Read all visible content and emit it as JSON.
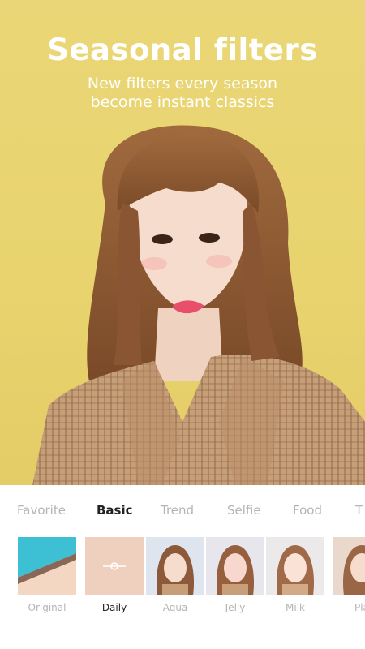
{
  "hero": {
    "title": "Seasonal filters",
    "subtitle_line1": "New filters every season",
    "subtitle_line2": "become instant classics",
    "background_color": "#e8d36e"
  },
  "category_tabs": [
    {
      "label": "Favorite",
      "active": false
    },
    {
      "label": "Basic",
      "active": true
    },
    {
      "label": "Trend",
      "active": false
    },
    {
      "label": "Selfie",
      "active": false
    },
    {
      "label": "Food",
      "active": false
    },
    {
      "label": "T",
      "active": false
    }
  ],
  "filters": [
    {
      "label": "Original",
      "active": false
    },
    {
      "label": "Daily",
      "active": true
    },
    {
      "label": "Aqua",
      "active": false
    },
    {
      "label": "Jelly",
      "active": false
    },
    {
      "label": "Milk",
      "active": false
    },
    {
      "label": "Pla",
      "active": false
    }
  ],
  "colors": {
    "accent_text": "#222222",
    "inactive_text": "#b4b4b4",
    "original_thumb_blue": "#3ec0d4",
    "daily_thumb": "#efcfbd"
  }
}
